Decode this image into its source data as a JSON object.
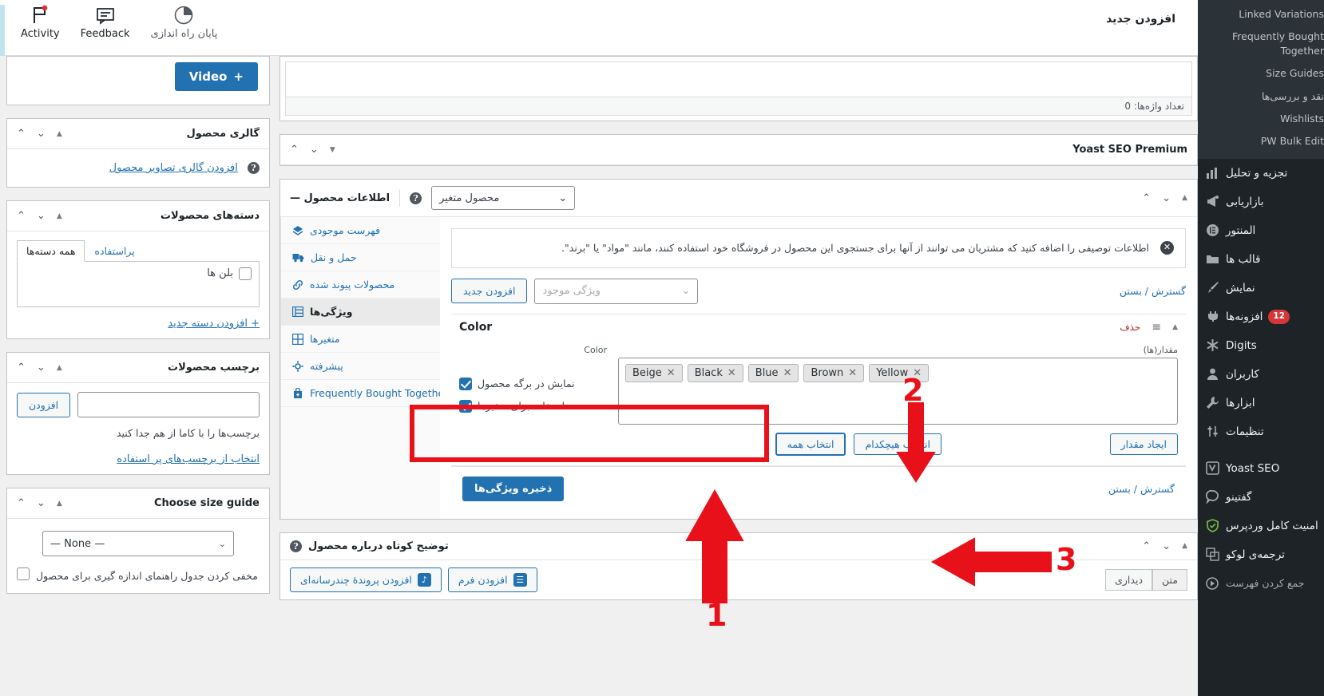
{
  "topbar": {
    "title": "افزودن جدید",
    "actions": [
      {
        "label": "پایان راه اندازی",
        "icon": "pie-progress-icon"
      },
      {
        "label": "Feedback",
        "icon": "comment-icon"
      },
      {
        "label": "Activity",
        "icon": "flag-icon"
      }
    ]
  },
  "adminmenu": {
    "submenu": [
      {
        "label": "Linked Variations"
      },
      {
        "label": "Frequently Bought Together"
      },
      {
        "label": "Size Guides"
      },
      {
        "label": "نقد و بررسی‌ها"
      },
      {
        "label": "Wishlists"
      },
      {
        "label": "PW Bulk Edit"
      }
    ],
    "items": [
      {
        "label": "تجزیه و تحلیل",
        "icon": "chart-bars-icon"
      },
      {
        "label": "بازاریابی",
        "icon": "megaphone-icon"
      },
      {
        "label": "المنتور",
        "icon": "elementor-icon"
      },
      {
        "label": "قالب ها",
        "icon": "appearance-icon"
      },
      {
        "label": "نمایش",
        "icon": "brush-icon"
      },
      {
        "label": "افزونه‌ها",
        "icon": "plugin-icon",
        "badge": "12"
      },
      {
        "label": "Digits",
        "icon": "asterisk-icon",
        "ltr": true
      },
      {
        "label": "کاربران",
        "icon": "user-icon"
      },
      {
        "label": "ابزارها",
        "icon": "wrench-icon"
      },
      {
        "label": "تنظیمات",
        "icon": "sliders-icon"
      },
      {
        "label": "Yoast SEO",
        "icon": "yoast-icon",
        "ltr": true,
        "gap_before": true
      },
      {
        "label": "گفتینو",
        "icon": "chat-bubble-icon"
      },
      {
        "label": "امنیت کامل وردپرس",
        "icon": "shield-icon"
      },
      {
        "label": "ترجمه‌ی لوکو",
        "icon": "translate-icon"
      },
      {
        "label": "جمع کردن فهرست",
        "icon": "collapse-icon",
        "dim": true
      }
    ]
  },
  "sidecol": {
    "video_button": "Video",
    "video_plus": "+",
    "gallery": {
      "title": "گالری محصول",
      "add_link": "افزودن گالری تصاویر محصول"
    },
    "categories": {
      "title": "دسته‌های محصولات",
      "tab_all": "همه دسته‌ها",
      "tab_used": "پراستفاده",
      "items": [
        {
          "label": "بلن ها",
          "checked": false
        }
      ],
      "add_new": "+ افزودن دسته جدید"
    },
    "tags": {
      "title": "برچسب محصولات",
      "input_value": "",
      "add_button": "افزودن",
      "hint": "برچسب‌ها را با کاما از هم جدا کنید",
      "choose_link": "انتخاب از برچسب‌های پر استفاده"
    },
    "size_guide": {
      "title": "Choose size guide",
      "selected": "— None —",
      "checkbox_label": "مخفی کردن جدول راهنمای اندازه گیری برای محصول",
      "checked": false
    }
  },
  "editor": {
    "word_count": "تعداد واژه‌ها: 0"
  },
  "yoast": {
    "title": "Yoast SEO Premium"
  },
  "product_data": {
    "title": "اطلاعات محصول —",
    "type_selected": "محصول متغیر",
    "help_icon": "?",
    "tabs": [
      {
        "label": "فهرست موجودی",
        "icon": "inventory-icon",
        "active": false
      },
      {
        "label": "حمل و نقل",
        "icon": "truck-icon",
        "active": false
      },
      {
        "label": "محصولات پیوند شده",
        "icon": "link-icon",
        "active": false
      },
      {
        "label": "ویژگی‌ها",
        "icon": "attributes-icon",
        "active": true
      },
      {
        "label": "متغیرها",
        "icon": "grid-icon",
        "active": false
      },
      {
        "label": "پیشرفته",
        "icon": "gear-icon",
        "active": false
      },
      {
        "label": "Frequently Bought Together",
        "icon": "bag-plus-icon",
        "active": false,
        "ltr": true
      }
    ],
    "notice": "اطلاعات توصیفی را اضافه کنید که مشتریان می توانند از آنها برای جستجوی این محصول در فروشگاه خود استفاده کنند، مانند \"مواد\" یا \"برند\".",
    "notice_dismiss": "✕",
    "toolbar": {
      "add_new": "افزودن جدید",
      "existing_placeholder": "ویژگی موجود",
      "expand_collapse": "گسترش / بستن"
    },
    "attribute": {
      "name": "Color",
      "remove_label": "حذف",
      "value_label": "مقدار(ها)",
      "name_label": "Color",
      "values": [
        {
          "label": "Yellow"
        },
        {
          "label": "Brown"
        },
        {
          "label": "Blue"
        },
        {
          "label": "Black"
        },
        {
          "label": "Beige"
        }
      ],
      "create_value_button": "ایجاد مقدار",
      "select_none_button": "انتخاب هیچکدام",
      "select_all_button": "انتخاب همه",
      "visible_checkbox_label": "نمایش در برگه محصول",
      "visible_checked": true,
      "variations_checkbox_label": "استفاده برای متغیرها",
      "variations_checked": true
    },
    "footer": {
      "save_button": "ذخیره ویژگی‌ها",
      "expand_collapse": "گسترش / بستن"
    }
  },
  "short_description": {
    "title": "توضیح کوتاه درباره محصول",
    "add_media": "افزودن پروندهٔ چندرسانه‌ای",
    "add_form": "افزودن فرم",
    "tab_visual": "دیداری",
    "tab_text": "متن"
  },
  "annotations": [
    {
      "number": "1",
      "target": "select-all-button"
    },
    {
      "number": "2",
      "target": "use-for-variations-checkbox"
    },
    {
      "number": "3",
      "target": "save-attributes-button"
    }
  ],
  "colors": {
    "accent": "#2271b1",
    "annotation_red": "#e8111a",
    "admin_bg": "#1d2327",
    "submenu_bg": "#2c3338",
    "badge_red": "#d63638"
  }
}
